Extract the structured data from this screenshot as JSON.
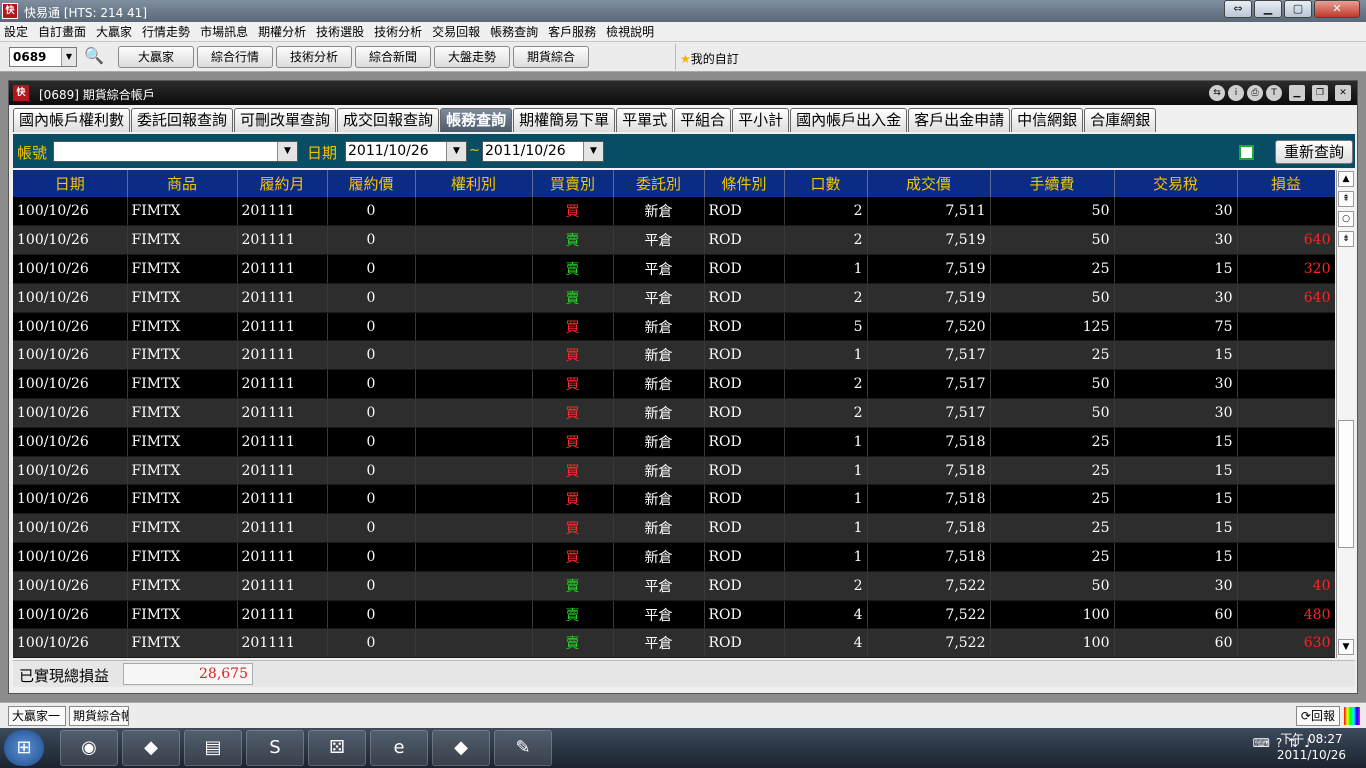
{
  "window": {
    "title": "快易通 [HTS: 214 41]",
    "app_icon": "快易通"
  },
  "menu": [
    "設定",
    "自訂畫面",
    "大贏家",
    "行情走勢",
    "市場訊息",
    "期權分析",
    "技術選股",
    "技術分析",
    "交易回報",
    "帳務查詢",
    "客戶服務",
    "檢視說明"
  ],
  "toolbar": {
    "code": "0689",
    "buttons": [
      "大贏家",
      "綜合行情",
      "技術分析",
      "綜合新聞",
      "大盤走勢",
      "期貨綜合"
    ],
    "favorite": "我的自訂"
  },
  "panel": {
    "title": "[0689] 期貨綜合帳戶",
    "icon": "期貨"
  },
  "tabs": [
    "國內帳戶權利數",
    "委託回報查詢",
    "可刪改單查詢",
    "成交回報查詢",
    "帳務查詢",
    "期權簡易下單",
    "平單式",
    "平組合",
    "平小計",
    "國內帳戶出入金",
    "客戶出金申請",
    "中信網銀",
    "合庫網銀"
  ],
  "active_tab": 4,
  "filter": {
    "account_label": "帳號",
    "account_value": "",
    "date_label": "日期",
    "date_from": "2011/10/26",
    "tilde": "~",
    "date_to": "2011/10/26",
    "requery": "重新查詢"
  },
  "table": {
    "headers": [
      "日期",
      "商品",
      "履約月",
      "履約價",
      "權利別",
      "買賣別",
      "委託別",
      "條件別",
      "口數",
      "成交價",
      "手續費",
      "交易稅",
      "損益"
    ],
    "rows": [
      [
        "100/10/26",
        "FIMTX",
        "201111",
        "0",
        "",
        "買",
        "新倉",
        "ROD",
        "2",
        "7,511",
        "50",
        "30",
        ""
      ],
      [
        "100/10/26",
        "FIMTX",
        "201111",
        "0",
        "",
        "賣",
        "平倉",
        "ROD",
        "2",
        "7,519",
        "50",
        "30",
        "640"
      ],
      [
        "100/10/26",
        "FIMTX",
        "201111",
        "0",
        "",
        "賣",
        "平倉",
        "ROD",
        "1",
        "7,519",
        "25",
        "15",
        "320"
      ],
      [
        "100/10/26",
        "FIMTX",
        "201111",
        "0",
        "",
        "賣",
        "平倉",
        "ROD",
        "2",
        "7,519",
        "50",
        "30",
        "640"
      ],
      [
        "100/10/26",
        "FIMTX",
        "201111",
        "0",
        "",
        "買",
        "新倉",
        "ROD",
        "5",
        "7,520",
        "125",
        "75",
        ""
      ],
      [
        "100/10/26",
        "FIMTX",
        "201111",
        "0",
        "",
        "買",
        "新倉",
        "ROD",
        "1",
        "7,517",
        "25",
        "15",
        ""
      ],
      [
        "100/10/26",
        "FIMTX",
        "201111",
        "0",
        "",
        "買",
        "新倉",
        "ROD",
        "2",
        "7,517",
        "50",
        "30",
        ""
      ],
      [
        "100/10/26",
        "FIMTX",
        "201111",
        "0",
        "",
        "買",
        "新倉",
        "ROD",
        "2",
        "7,517",
        "50",
        "30",
        ""
      ],
      [
        "100/10/26",
        "FIMTX",
        "201111",
        "0",
        "",
        "買",
        "新倉",
        "ROD",
        "1",
        "7,518",
        "25",
        "15",
        ""
      ],
      [
        "100/10/26",
        "FIMTX",
        "201111",
        "0",
        "",
        "買",
        "新倉",
        "ROD",
        "1",
        "7,518",
        "25",
        "15",
        ""
      ],
      [
        "100/10/26",
        "FIMTX",
        "201111",
        "0",
        "",
        "買",
        "新倉",
        "ROD",
        "1",
        "7,518",
        "25",
        "15",
        ""
      ],
      [
        "100/10/26",
        "FIMTX",
        "201111",
        "0",
        "",
        "買",
        "新倉",
        "ROD",
        "1",
        "7,518",
        "25",
        "15",
        ""
      ],
      [
        "100/10/26",
        "FIMTX",
        "201111",
        "0",
        "",
        "買",
        "新倉",
        "ROD",
        "1",
        "7,518",
        "25",
        "15",
        ""
      ],
      [
        "100/10/26",
        "FIMTX",
        "201111",
        "0",
        "",
        "賣",
        "平倉",
        "ROD",
        "2",
        "7,522",
        "50",
        "30",
        "40"
      ],
      [
        "100/10/26",
        "FIMTX",
        "201111",
        "0",
        "",
        "賣",
        "平倉",
        "ROD",
        "4",
        "7,522",
        "100",
        "60",
        "480"
      ],
      [
        "100/10/26",
        "FIMTX",
        "201111",
        "0",
        "",
        "賣",
        "平倉",
        "ROD",
        "4",
        "7,522",
        "100",
        "60",
        "630"
      ]
    ]
  },
  "summary": {
    "label": "已實現總損益",
    "value": "28,675"
  },
  "statusbar": {
    "tabs": [
      "大贏家一",
      "期貨綜合帳戶"
    ],
    "reply": "回報"
  },
  "clock": {
    "time": "下午 08:27",
    "date": "2011/10/26"
  },
  "colors": {
    "buy": "#ff2a2a",
    "sell": "#26d826",
    "header_bg": "#0a2c85",
    "header_text": "#f5c400",
    "filter_bg": "#074e65"
  }
}
